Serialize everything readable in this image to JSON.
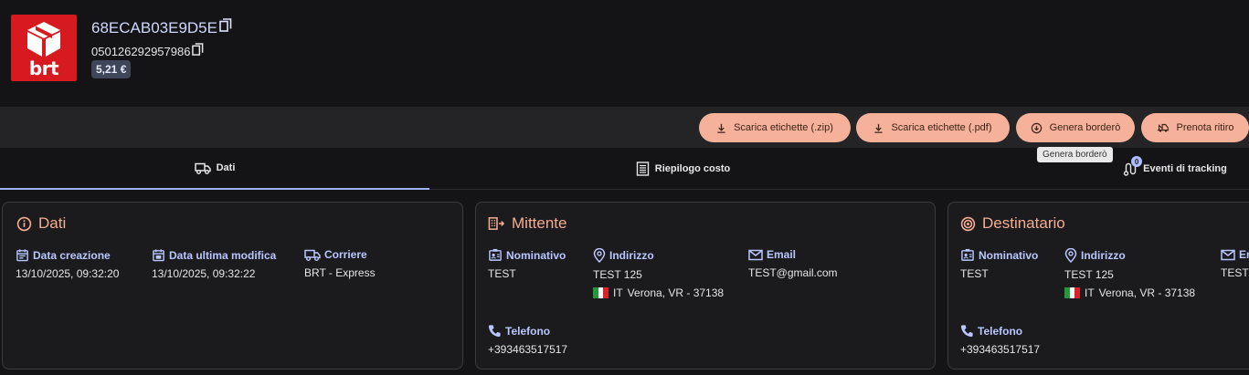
{
  "header": {
    "logo_text": "brt",
    "shipment_id": "68ECAB03E9D5E",
    "tracking_number": "050126292957986",
    "price": "5,21 €"
  },
  "toolbar": {
    "buttons": [
      {
        "label": "Scarica etichette (.zip)",
        "icon": "download-icon"
      },
      {
        "label": "Scarica etichette (.pdf)",
        "icon": "download-icon"
      },
      {
        "label": "Genera borderò",
        "icon": "download-circle-icon"
      },
      {
        "label": "Prenota ritiro",
        "icon": "pickup-truck-icon"
      }
    ],
    "tooltip": "Genera borderò"
  },
  "tabs": [
    {
      "label": "Dati",
      "icon": "truck-icon",
      "active": true
    },
    {
      "label": "Riepilogo costo",
      "icon": "receipt-icon",
      "active": false
    },
    {
      "label": "Eventi di tracking",
      "icon": "route-icon",
      "active": false,
      "badge": "0"
    }
  ],
  "dati": {
    "title": "Dati",
    "fields": [
      {
        "label": "Data creazione",
        "value": "13/10/2025, 09:32:20"
      },
      {
        "label": "Data ultima modifica",
        "value": "13/10/2025, 09:32:22"
      },
      {
        "label": "Corriere",
        "value": "BRT - Express"
      }
    ]
  },
  "mittente": {
    "title": "Mittente",
    "nominativo_label": "Nominativo",
    "nominativo": "TEST",
    "indirizzo_label": "Indirizzo",
    "indirizzo_line1": "TEST 125",
    "country": "IT",
    "indirizzo_line2": "Verona, VR - 37138",
    "email_label": "Email",
    "email": "TEST@gmail.com",
    "telefono_label": "Telefono",
    "telefono": "+393463517517"
  },
  "destinatario": {
    "title": "Destinatario",
    "nominativo_label": "Nominativo",
    "nominativo": "TEST",
    "indirizzo_label": "Indirizzo",
    "indirizzo_line1": "TEST 125",
    "country": "IT",
    "indirizzo_line2": "Verona, VR - 37138",
    "email_label": "Email",
    "email": "TEST@gmail.com",
    "telefono_label": "Telefono",
    "telefono": "+393463517517"
  },
  "colors": {
    "accent": "#f6b19a",
    "label_blue": "#b9c7ff",
    "title_orange": "#f5ad91",
    "brand_red": "#d71920"
  }
}
